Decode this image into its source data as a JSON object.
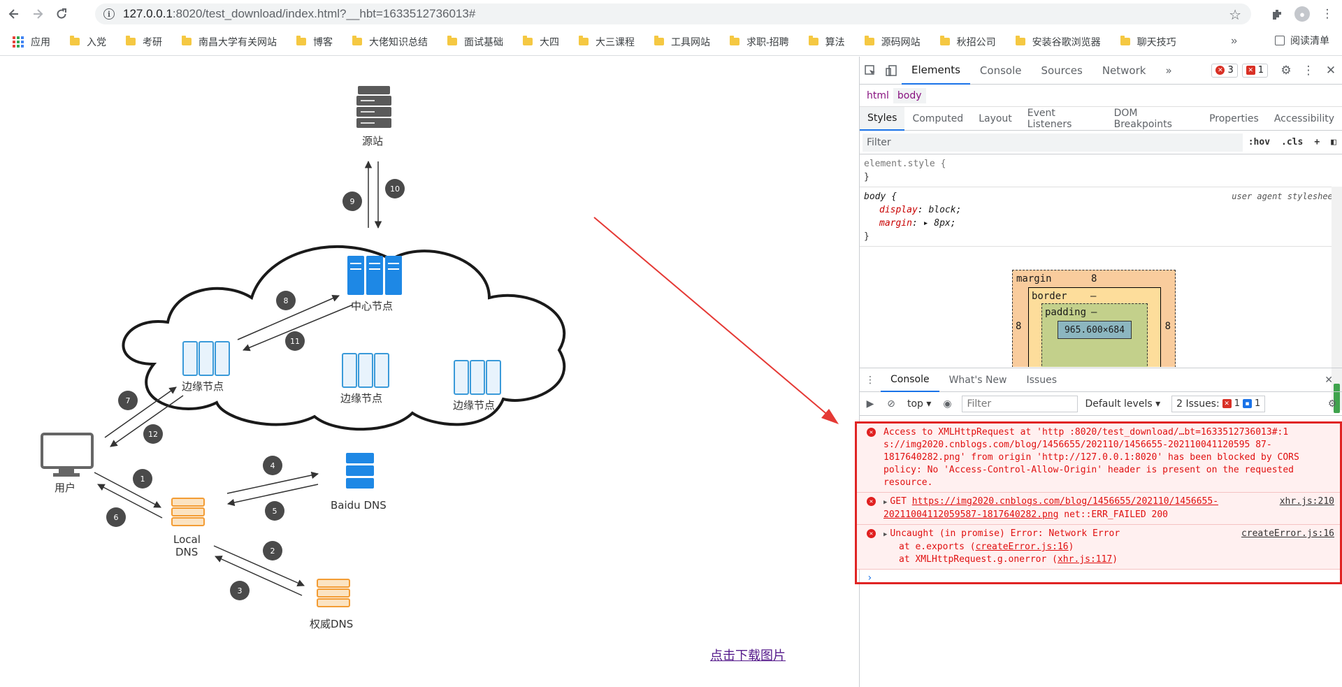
{
  "browser": {
    "url_host": "127.0.0.1",
    "url_path": ":8020/test_download/index.html?__hbt=1633512736013#",
    "bookmarks": [
      "应用",
      "入党",
      "考研",
      "南昌大学有关网站",
      "博客",
      "大佬知识总结",
      "面试基础",
      "大四",
      "大三课程",
      "工具网站",
      "求职-招聘",
      "算法",
      "源码网站",
      "秋招公司",
      "安装谷歌浏览器",
      "聊天技巧"
    ],
    "more_label": "»",
    "reading_list": "阅读清单"
  },
  "diagram": {
    "source": "源站",
    "center": "中心节点",
    "edge1": "边缘节点",
    "edge2": "边缘节点",
    "edge3": "边缘节点",
    "user": "用户",
    "local_dns_1": "Local",
    "local_dns_2": "DNS",
    "baidu_dns": "Baidu DNS",
    "auth_dns": "权威DNS",
    "steps": [
      "1",
      "2",
      "3",
      "4",
      "5",
      "6",
      "7",
      "8",
      "9",
      "10",
      "11",
      "12"
    ]
  },
  "page": {
    "download_link": "点击下载图片"
  },
  "devtools": {
    "tabs": [
      "Elements",
      "Console",
      "Sources",
      "Network"
    ],
    "more_tabs": "»",
    "error_count": "3",
    "issue_count": "1",
    "breadcrumbs": [
      "html",
      "body"
    ],
    "style_tabs": [
      "Styles",
      "Computed",
      "Layout",
      "Event Listeners",
      "DOM Breakpoints",
      "Properties",
      "Accessibility"
    ],
    "filter_placeholder": "Filter",
    "hov": ":hov",
    "cls": ".cls",
    "element_style": "element.style {",
    "close_brace": "}",
    "body_rule": "body {",
    "ua_label": "user agent stylesheet",
    "prop1_name": "display",
    "prop1_val": "block;",
    "prop2_name": "margin",
    "prop2_val": "8px;",
    "box": {
      "margin_label": "margin",
      "margin_top": "8",
      "margin_left": "8",
      "margin_right": "8",
      "border_label": "border",
      "border_val": "–",
      "padding_label": "padding",
      "padding_val": "–",
      "content": "965.600×684"
    },
    "drawer_tabs": [
      "Console",
      "What's New",
      "Issues"
    ],
    "context": "top",
    "console_filter": "Filter",
    "levels": "Default levels",
    "issues_label": "2 Issues:",
    "issues_err": "1",
    "issues_info": "1",
    "messages": [
      {
        "text": "Access to XMLHttpRequest at 'http    :8020/test_download/…bt=1633512736013#:1 s://img2020.cnblogs.com/blog/1456655/202110/1456655-202110041120595 87-1817640282.png' from origin 'http://127.0.0.1:8020' has been blocked by CORS policy: No 'Access-Control-Allow-Origin' header is present on the requested resource."
      },
      {
        "prefix": "GET",
        "url": "https://img2020.cnblogs.com/blog/1456655/202110/1456655-20211004112059587-1817640282.png",
        "status": "net::ERR_FAILED 200",
        "src": "xhr.js:210"
      },
      {
        "text": "Uncaught (in promise) Error: Network Error",
        "src": "createError.js:16",
        "stack1_pre": "at e.exports (",
        "stack1_link": "createError.js:16",
        "stack1_post": ")",
        "stack2_pre": "at XMLHttpRequest.g.onerror (",
        "stack2_link": "xhr.js:117",
        "stack2_post": ")"
      }
    ],
    "prompt": "›"
  }
}
